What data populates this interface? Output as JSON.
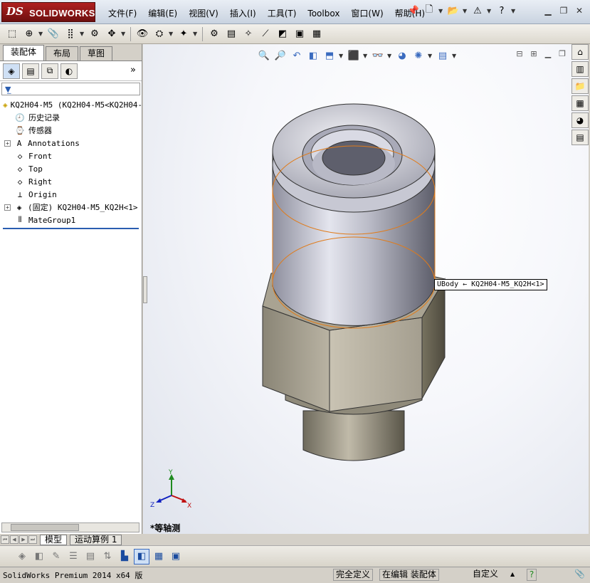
{
  "app": {
    "logo_ds": "DS",
    "logo_name": "SOLIDWORKS"
  },
  "menu": [
    "文件(F)",
    "编辑(E)",
    "视图(V)",
    "插入(I)",
    "工具(T)",
    "Toolbox",
    "窗口(W)",
    "帮助(H)"
  ],
  "panel": {
    "tabs": [
      "装配体",
      "布局",
      "草图"
    ],
    "more": "»"
  },
  "tree": {
    "root": "KQ2H04-M5  (KQ2H04-M5<KQ2H04-",
    "items": [
      {
        "label": "历史记录",
        "icon": "history-icon",
        "glyph": "🕘",
        "expandable": false
      },
      {
        "label": "传感器",
        "icon": "sensor-icon",
        "glyph": "⌚",
        "expandable": false
      },
      {
        "label": "Annotations",
        "icon": "annotations-icon",
        "glyph": "A",
        "expandable": true
      },
      {
        "label": "Front",
        "icon": "plane-icon",
        "glyph": "◇",
        "expandable": false
      },
      {
        "label": "Top",
        "icon": "plane-icon",
        "glyph": "◇",
        "expandable": false
      },
      {
        "label": "Right",
        "icon": "plane-icon",
        "glyph": "◇",
        "expandable": false
      },
      {
        "label": "Origin",
        "icon": "origin-icon",
        "glyph": "⊥",
        "expandable": false
      },
      {
        "label": "(固定) KQ2H04-M5_KQ2H<1>",
        "icon": "part-icon",
        "glyph": "◈",
        "expandable": true
      },
      {
        "label": "MateGroup1",
        "icon": "mates-icon",
        "glyph": "⫴",
        "expandable": false
      }
    ]
  },
  "viewport": {
    "tooltip": "UBody ← KQ2H04-M5_KQ2H<1>",
    "view_name": "*等轴测",
    "axis_x": "X",
    "axis_y": "Y",
    "axis_z": "Z"
  },
  "bottom_tabs": [
    "模型",
    "运动算例 1"
  ],
  "status": {
    "left": "SolidWorks Premium 2014 x64 版",
    "state": "完全定义",
    "mode": "在编辑 装配体",
    "units": "自定义",
    "arrow": "▲",
    "help": "?"
  },
  "colors": {
    "accent": "#2a5db0",
    "highlight_edge": "#e07b1a",
    "logo_red": "#9a1b1b"
  }
}
